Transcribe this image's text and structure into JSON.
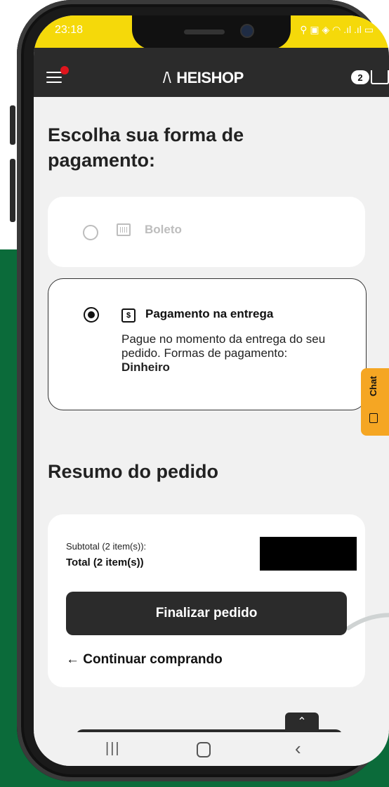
{
  "status_bar": {
    "time": "23:18",
    "icons": "⚲ ▣   ◈ ◠ .ıl .ıl ▭"
  },
  "header": {
    "logo": "HEISHOP",
    "logo_mark": "/\\",
    "cart_count": "2"
  },
  "payment": {
    "title": "Escolha sua forma de pagamento:",
    "options": [
      {
        "label": "Boleto",
        "selected": false
      },
      {
        "label": "Pagamento na entrega",
        "selected": true,
        "description": "Pague no momento da entrega do seu pedido. Formas de pagamento:",
        "description_bold": "Dinheiro"
      }
    ]
  },
  "chat": {
    "label": "Chat"
  },
  "summary": {
    "title": "Resumo do pedido",
    "subtotal_label": "Subtotal (2 item(s)):",
    "total_label": "Total (2 item(s))",
    "finalize_button": "Finalizar pedido",
    "continue_link": "← Continuar comprando"
  },
  "scroll_top": "⌃",
  "nav": {
    "recent": "|||",
    "back": "‹"
  },
  "colors": {
    "accent": "#f5d90a",
    "dark": "#2b2b2b",
    "chat": "#f5a623",
    "background_green": "#0b6b3a",
    "badge": "#e0151d"
  }
}
